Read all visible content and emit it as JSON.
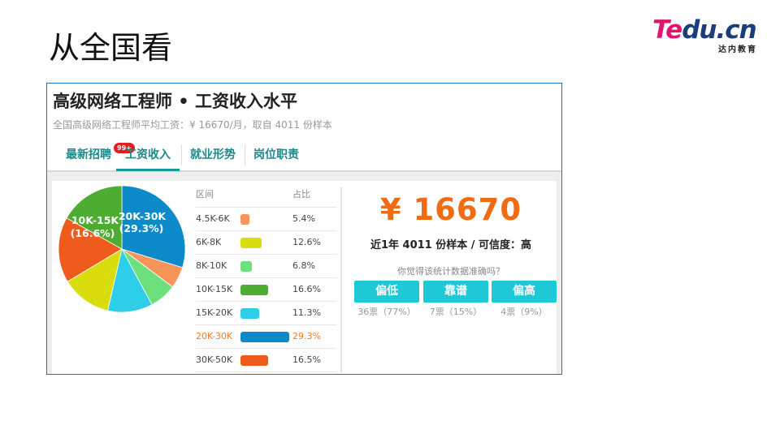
{
  "slide": {
    "title": "从全国看"
  },
  "logo": {
    "part1": "Te",
    "part2": "du.cn",
    "sub": "达内教育",
    "color1": "#e0156e",
    "color2": "#1b3e7a"
  },
  "job": {
    "title": "高级网络工程师 • 工资收入水平",
    "subtitle": "全国高级网络工程师平均工资：¥ 16670/月，取自 4011 份样本"
  },
  "tabs": [
    {
      "label": "最新招聘",
      "badge": "99+"
    },
    {
      "label": "工资收入",
      "active": true
    },
    {
      "label": "就业形势"
    },
    {
      "label": "岗位职责"
    }
  ],
  "table": {
    "headers": [
      "区间",
      "占比"
    ],
    "rows": [
      {
        "range": "4.5K-6K",
        "pct": "5.4%",
        "color": "#f7945a"
      },
      {
        "range": "6K-8K",
        "pct": "12.6%",
        "color": "#d9dd0e"
      },
      {
        "range": "8K-10K",
        "pct": "6.8%",
        "color": "#6ce07a"
      },
      {
        "range": "10K-15K",
        "pct": "16.6%",
        "color": "#4dad32"
      },
      {
        "range": "15K-20K",
        "pct": "11.3%",
        "color": "#2ecde8"
      },
      {
        "range": "20K-30K",
        "pct": "29.3%",
        "color": "#0c8ac9",
        "highlight": true
      },
      {
        "range": "30K-50K",
        "pct": "16.5%",
        "color": "#ef5a1d"
      }
    ]
  },
  "pie_labels": [
    {
      "range": "20K-30K",
      "pct": "(29.3%)"
    },
    {
      "range": "10K-15K",
      "pct": "(16.6%)"
    }
  ],
  "summary": {
    "salary": "¥ 16670",
    "sample": "近1年 4011 份样本 / 可信度：高",
    "question": "你觉得该统计数据准确吗？"
  },
  "votes": [
    {
      "label": "偏低",
      "count": "36票（77%）"
    },
    {
      "label": "靠谱",
      "count": "7票（15%）"
    },
    {
      "label": "偏高",
      "count": "4票（9%）"
    }
  ],
  "chart_data": {
    "type": "pie",
    "categories": [
      "4.5K-6K",
      "6K-8K",
      "8K-10K",
      "10K-15K",
      "15K-20K",
      "20K-30K",
      "30K-50K"
    ],
    "values": [
      5.4,
      12.6,
      6.8,
      16.6,
      11.3,
      29.3,
      16.5
    ],
    "colors": [
      "#f7945a",
      "#d9dd0e",
      "#6ce07a",
      "#4dad32",
      "#2ecde8",
      "#0c8ac9",
      "#ef5a1d"
    ],
    "slice_order": [
      "20K-30K",
      "4.5K-6K",
      "8K-10K",
      "15K-20K",
      "6K-8K",
      "30K-50K",
      "10K-15K"
    ]
  }
}
